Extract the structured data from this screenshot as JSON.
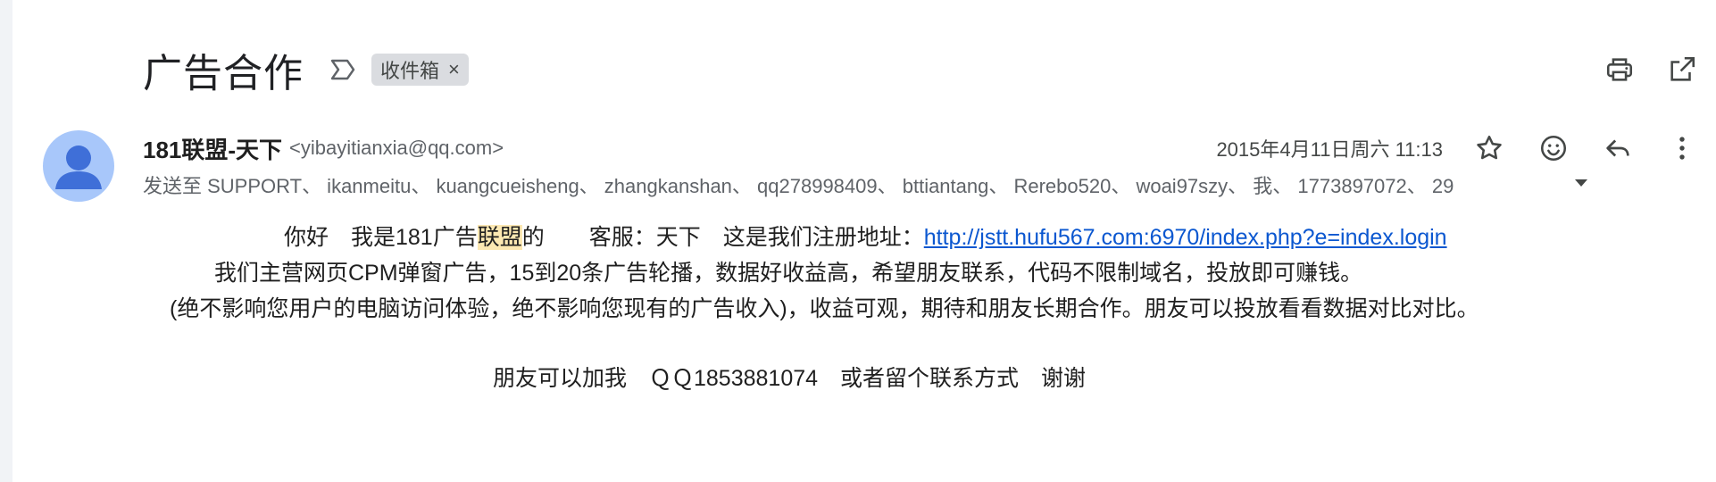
{
  "email": {
    "subject": "广告合作",
    "label_chip": "收件箱",
    "label_chip_close": "×",
    "sender_name": "181联盟-天下",
    "sender_email": "<yibayitianxia@qq.com>",
    "date": "2015年4月11日周六 11:13",
    "recipients": "发送至 SUPPORT、 ikanmeitu、 kuangcueisheng、 zhangkanshan、 qq278998409、 bttiantang、 Rerebo520、 woai97szy、 我、 1773897072、 29",
    "body": {
      "line1_pre": "你好　我是181广告",
      "line1_highlight": "联盟",
      "line1_post": "的　　客服：天下　这是我们注册地址：",
      "line1_link": "http://jstt.hufu567.com:6970/index.php?e=index.login",
      "line2": "我们主营网页CPM弹窗广告，15到20条广告轮播，数据好收益高，希望朋友联系，代码不限制域名，投放即可赚钱。",
      "line3": "(绝不影响您用户的电脑访问体验，绝不影响您现有的广告收入)，收益可观，期待和朋友长期合作。朋友可以投放看看数据对比对比。",
      "line4": "朋友可以加我　ＱＱ1853881074　或者留个联系方式　谢谢"
    }
  },
  "icons": {
    "top_actions": [
      "print-icon",
      "open-in-new-window-icon"
    ],
    "meta_actions": [
      "star-icon",
      "emoji-icon",
      "reply-icon",
      "more-vert-icon"
    ]
  }
}
